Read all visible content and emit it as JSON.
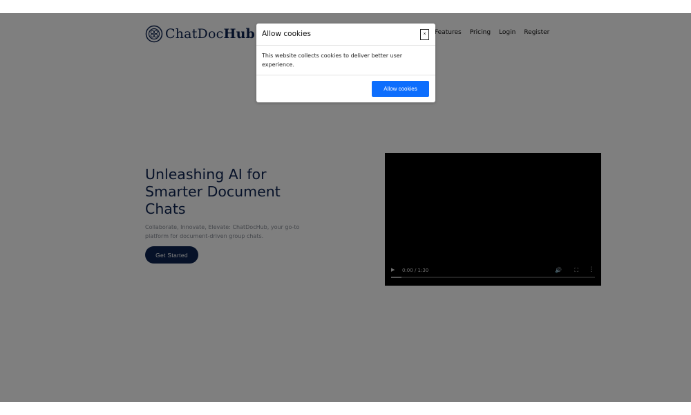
{
  "brand": {
    "name_light": "ChatDoc",
    "name_bold": "Hub"
  },
  "nav": {
    "items": [
      "Features",
      "Pricing",
      "Login",
      "Register"
    ]
  },
  "hero": {
    "title": "Unleashing AI for Smarter Document Chats",
    "subtitle": "Collaborate, Innovate, Elevate: ChatDocHub, your go-to platform for document-driven group chats.",
    "cta_label": "Get Started"
  },
  "video": {
    "time": "0:00 / 1:30",
    "progress": 0.05
  },
  "cookie_modal": {
    "title": "Allow cookies",
    "close_glyph": "×",
    "message": "This website collects cookies to deliver better user experience.",
    "button_label": "Allow cookies"
  },
  "colors": {
    "brand_navy": "#0c2350",
    "accent_blue": "#0d6efd"
  }
}
